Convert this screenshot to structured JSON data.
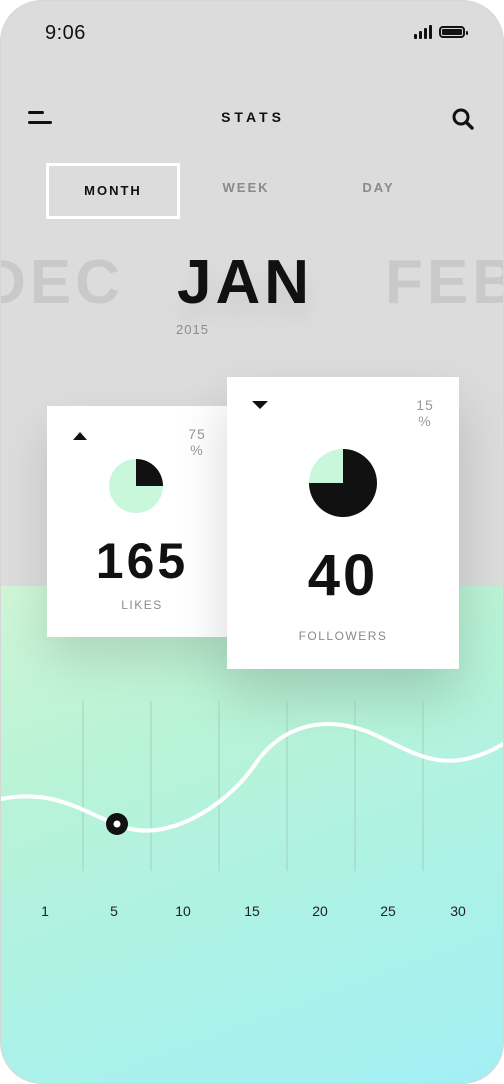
{
  "status_bar": {
    "time": "9:06"
  },
  "header": {
    "title": "STATS"
  },
  "tabs": [
    {
      "label": "MONTH",
      "active": true
    },
    {
      "label": "WEEK",
      "active": false
    },
    {
      "label": "DAY",
      "active": false
    }
  ],
  "month_carousel": {
    "prev": "DEC",
    "current": "JAN",
    "next": "FEB",
    "year": "2015"
  },
  "cards": {
    "likes": {
      "value": "165",
      "label": "LIKES",
      "percent_number": "75",
      "percent_sign": "%",
      "trend": "up",
      "pie_fraction": 0.25
    },
    "followers": {
      "value": "40",
      "label": "FOLLOWERS",
      "percent_number": "15",
      "percent_sign": "%",
      "trend": "down",
      "pie_fraction": 0.75
    }
  },
  "chart": {
    "x_labels": [
      "1",
      "5",
      "10",
      "15",
      "20",
      "25",
      "30"
    ],
    "selected_day": "5"
  },
  "colors": {
    "accent_mint": "#c8f7dc",
    "text_dark": "#111111",
    "background_gray": "#dcdcdd",
    "gradient_start": "#cff5d6",
    "gradient_end": "#a3eff5"
  }
}
